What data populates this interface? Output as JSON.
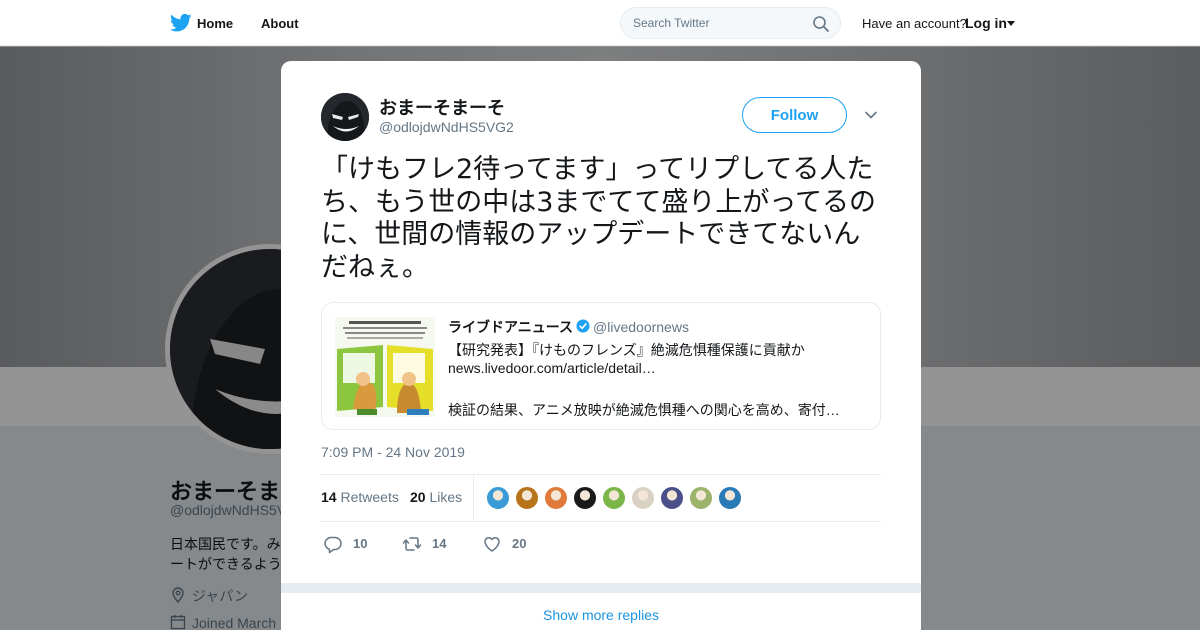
{
  "topnav": {
    "home_label": "Home",
    "about_label": "About",
    "search_placeholder": "Search Twitter",
    "have_account": "Have an account?",
    "login_label": "Log in"
  },
  "profile": {
    "name": "おまーそま",
    "handle": "@odlojdwNdHS5V",
    "bio_line1": "日本国民です。み",
    "bio_line2": "ートができるよう",
    "location": "ジャパン",
    "joined": "Joined March"
  },
  "tweet": {
    "author_name": "おまーそまーそ",
    "author_handle": "@odlojdwNdHS5VG2",
    "follow_label": "Follow",
    "text": "「けもフレ2待ってます」ってリプしてる人たち、もう世の中は3までてて盛り上がってるのに、世間の情報のアップデートできてないんだねぇ。",
    "quote": {
      "name": "ライブドアニュース",
      "handle": "@livedoornews",
      "line1": "【研究発表】『けものフレンズ』絶滅危惧種保護に貢献か",
      "line2": "news.livedoor.com/article/detail…",
      "line3": "検証の結果、アニメ放映が絶滅危惧種への関心を高め、寄付…",
      "thumb_title": "資金は相関性アップ！"
    },
    "timestamp": "7:09 PM - 24 Nov 2019",
    "retweets_count": "14",
    "retweets_label": "Retweets",
    "likes_count": "20",
    "likes_label": "Likes",
    "actions": {
      "replies": "10",
      "retweets": "14",
      "likes": "20"
    },
    "show_more": "Show more replies"
  },
  "colors": {
    "accent": "#1da1f2",
    "link": "#1b95e0",
    "text": "#14171a",
    "muted": "#657786"
  },
  "likers": [
    {
      "icon": "liker-avatar-1",
      "color": "#3a9bd6"
    },
    {
      "icon": "liker-avatar-2",
      "color": "#b8741a"
    },
    {
      "icon": "liker-avatar-3",
      "color": "#e07a3a"
    },
    {
      "icon": "liker-avatar-4",
      "color": "#1a1a1a"
    },
    {
      "icon": "liker-avatar-5",
      "color": "#7ab648"
    },
    {
      "icon": "liker-avatar-6",
      "color": "#d9d2c4"
    },
    {
      "icon": "liker-avatar-7",
      "color": "#4a4f8a"
    },
    {
      "icon": "liker-avatar-8",
      "color": "#9bb36a"
    },
    {
      "icon": "liker-avatar-9",
      "color": "#2a7ab8"
    }
  ]
}
